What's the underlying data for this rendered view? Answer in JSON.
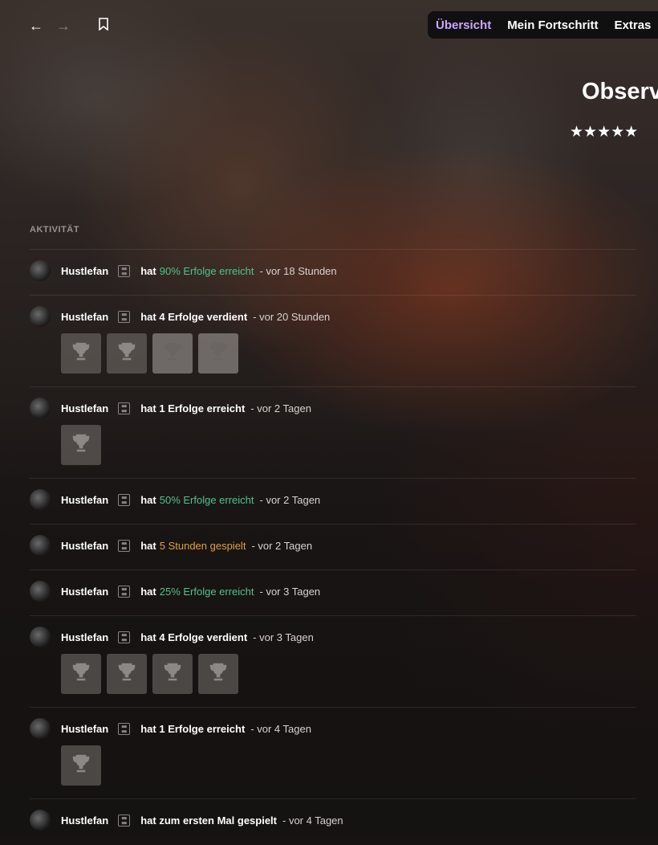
{
  "topbar": {
    "back_icon": "arrow-left-icon",
    "forward_icon": "arrow-right-icon",
    "bookmark_icon": "bookmark-icon",
    "tabs": [
      {
        "label": "Übersicht",
        "active": true
      },
      {
        "label": "Mein Fortschritt",
        "active": false
      },
      {
        "label": "Extras",
        "active": false
      }
    ]
  },
  "game": {
    "title": "Observ",
    "stars": "★★★★★"
  },
  "activity": {
    "section_label": "AKTIVITÄT",
    "accent_green": "#4fc38a",
    "accent_orange": "#e0a040",
    "items": [
      {
        "user": "Hustlefan",
        "verb": "hat",
        "highlight": "90% Erfolge erreicht",
        "color": "green",
        "time": "- vor 18 Stunden",
        "achievements": 0
      },
      {
        "user": "Hustlefan",
        "verb": "hat 4 Erfolge verdient",
        "highlight": "",
        "time": "- vor 20 Stunden",
        "achievements": 4
      },
      {
        "user": "Hustlefan",
        "verb": "hat 1 Erfolge erreicht",
        "highlight": "",
        "time": "- vor 2 Tagen",
        "achievements": 1
      },
      {
        "user": "Hustlefan",
        "verb": "hat",
        "highlight": "50% Erfolge erreicht",
        "color": "green",
        "time": "- vor 2 Tagen",
        "achievements": 0
      },
      {
        "user": "Hustlefan",
        "verb": "hat",
        "highlight": "5 Stunden gespielt",
        "color": "orange",
        "time": "- vor 2 Tagen",
        "achievements": 0
      },
      {
        "user": "Hustlefan",
        "verb": "hat",
        "highlight": "25% Erfolge erreicht",
        "color": "green",
        "time": "- vor 3 Tagen",
        "achievements": 0
      },
      {
        "user": "Hustlefan",
        "verb": "hat 4 Erfolge verdient",
        "highlight": "",
        "time": "- vor 3 Tagen",
        "achievements": 4
      },
      {
        "user": "Hustlefan",
        "verb": "hat 1 Erfolge erreicht",
        "highlight": "",
        "time": "- vor 4 Tagen",
        "achievements": 1
      },
      {
        "user": "Hustlefan",
        "verb": "hat zum ersten Mal gespielt",
        "highlight": "",
        "time": "- vor 4 Tagen",
        "achievements": 0
      }
    ]
  }
}
